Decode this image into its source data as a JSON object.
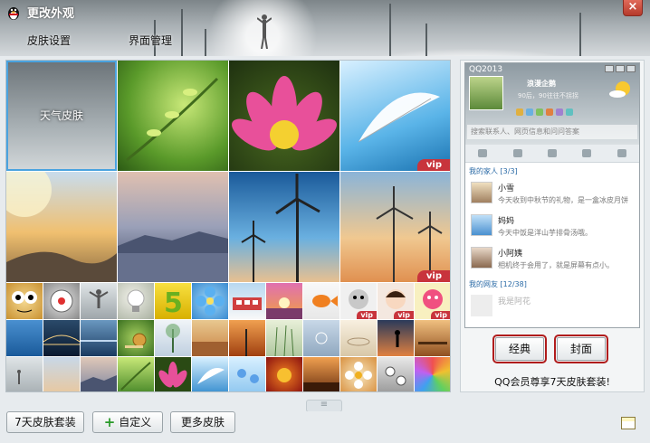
{
  "window": {
    "title": "更改外观",
    "close_icon": "close-icon",
    "app_icon": "qq-penguin-icon"
  },
  "tabs": [
    {
      "label": "皮肤设置"
    },
    {
      "label": "界面管理"
    }
  ],
  "gallery": {
    "big_tiles": [
      {
        "name": "weather-skin",
        "label": "天气皮肤",
        "vip": "",
        "selected": true
      },
      {
        "name": "green-sprout",
        "label": "",
        "vip": ""
      },
      {
        "name": "lotus",
        "label": "",
        "vip": ""
      },
      {
        "name": "feather",
        "label": "",
        "vip": "vip"
      },
      {
        "name": "sunrise-clouds",
        "label": "",
        "vip": ""
      },
      {
        "name": "mountain-sunset",
        "label": "",
        "vip": ""
      },
      {
        "name": "windmill",
        "label": "",
        "vip": ""
      },
      {
        "name": "windmill-sunset",
        "label": "",
        "vip": "vip"
      }
    ],
    "small_vip_label": "vip"
  },
  "preview": {
    "qq": {
      "title": "QQ2013",
      "nickname": "浪漫企鹅",
      "signature": "90后，90往往不拐拐",
      "search_placeholder": "搜索联系人、网页信息和问问答案",
      "group1": "我的家人 [3/3]",
      "group2": "我的网友 [12/38]",
      "friends": [
        {
          "name": "小雪",
          "message": "今天收到中秋节的礼物，是一盒冰皮月饼"
        },
        {
          "name": "妈妈",
          "message": "今天中饭是洋山芋排骨汤哦。"
        },
        {
          "name": "小阿姨",
          "message": "相机终于会用了，就是屏幕有点小。"
        },
        {
          "name": "我是阿花",
          "message": ""
        }
      ]
    },
    "mode_buttons": [
      {
        "label": "经典"
      },
      {
        "label": "封面"
      }
    ],
    "vip_promo": "QQ会员尊享7天皮肤套装!"
  },
  "bottom": {
    "btn_suite": "7天皮肤套装",
    "btn_custom": "自定义",
    "btn_more": "更多皮肤",
    "collapse_icon": "collapse-handle-icon",
    "corner_icon": "skin-box-icon"
  }
}
